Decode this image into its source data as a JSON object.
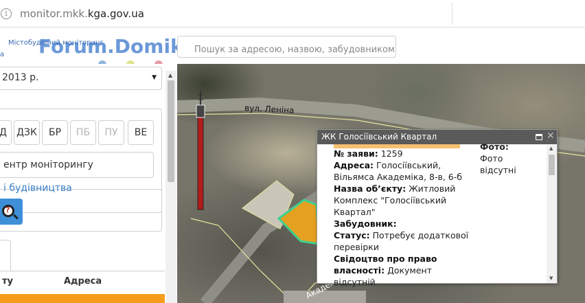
{
  "browser": {
    "url_prefix": "monitor.mkk.",
    "url_domain": "kga.gov.ua"
  },
  "header": {
    "brand": "Містобудівний моніторинг",
    "brand_tail": "а",
    "watermark": "Forum.Domik.ua",
    "search_placeholder": "Пошук за адресою, назвою, забудовником...",
    "dot_colors": [
      "#8db4dc",
      "#dfe38b",
      "#e59aa6"
    ]
  },
  "panel": {
    "year_select": "2013 р.",
    "filter_buttons": [
      {
        "label": "Д",
        "disabled": false
      },
      {
        "label": "ДЗК",
        "disabled": false
      },
      {
        "label": "БР",
        "disabled": false
      },
      {
        "label": "ПБ",
        "disabled": true
      },
      {
        "label": "ПУ",
        "disabled": true
      },
      {
        "label": "ВЕ",
        "disabled": false
      }
    ],
    "center_button": "ентр моніторингу",
    "construction_link": "і будівництва",
    "table_headers": [
      "ту",
      "Адреса"
    ]
  },
  "map": {
    "street_label": "вул. Леніна",
    "bottom_label": "Академ",
    "popup": {
      "title": "ЖК Голосіївський Квартал",
      "fields": [
        {
          "label": "№ заяви:",
          "value": "1259"
        },
        {
          "label": "Адреса:",
          "value": "Голосіївський, Вільямса Академіка, 8-в, 6-б"
        },
        {
          "label": "Назва об’єкту:",
          "value": "Житловий Комплекс \"Голосіївський Квартал\""
        },
        {
          "label": "Забудовник:",
          "value": ""
        },
        {
          "label": "Статус:",
          "value": "Потребує додаткової перевірки"
        },
        {
          "label": "Свідоцтво про право власності:",
          "value": "Документ відсутній"
        }
      ],
      "photo_label": "Фото:",
      "photo_value": "Фото відсутні"
    }
  }
}
